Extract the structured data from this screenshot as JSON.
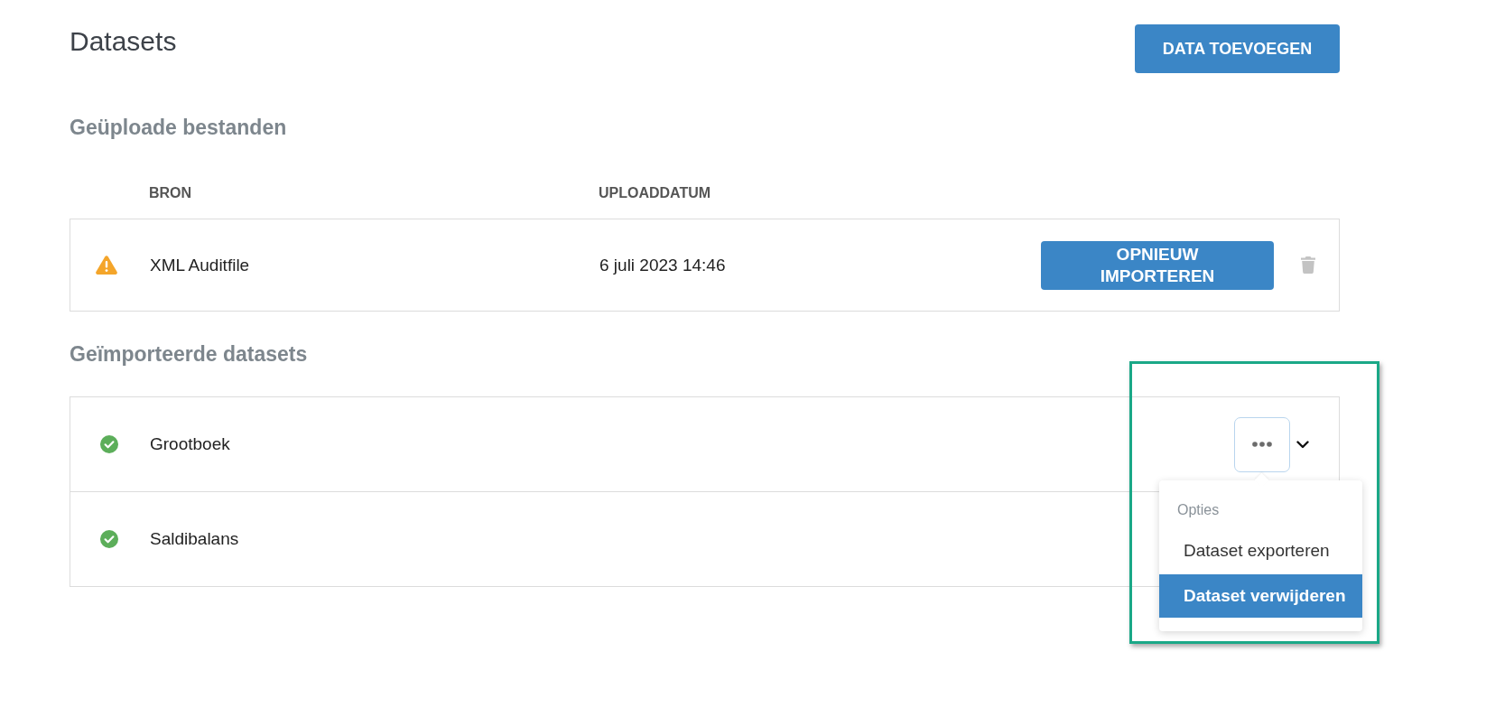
{
  "page": {
    "title": "Datasets",
    "add_button": "DATA TOEVOEGEN"
  },
  "uploaded": {
    "heading": "Geüploade bestanden",
    "columns": [
      "BRON",
      "UPLOADDATUM"
    ],
    "rows": [
      {
        "kind": "warning",
        "source": "XML Auditfile",
        "date": "6 juli 2023 14:46",
        "action": "OPNIEUW IMPORTEREN"
      }
    ]
  },
  "imported": {
    "heading": "Geïmporteerde datasets",
    "rows": [
      {
        "kind": "ok",
        "name": "Grootboek",
        "actions": {
          "open": true,
          "highlighted": true,
          "menu": {
            "heading": "Opties",
            "items": [
              {
                "label": "Dataset exporteren",
                "selected": false
              },
              {
                "label": "Dataset verwijderen",
                "selected": true
              }
            ]
          }
        }
      },
      {
        "kind": "ok",
        "name": "Saldibalans"
      }
    ]
  }
}
